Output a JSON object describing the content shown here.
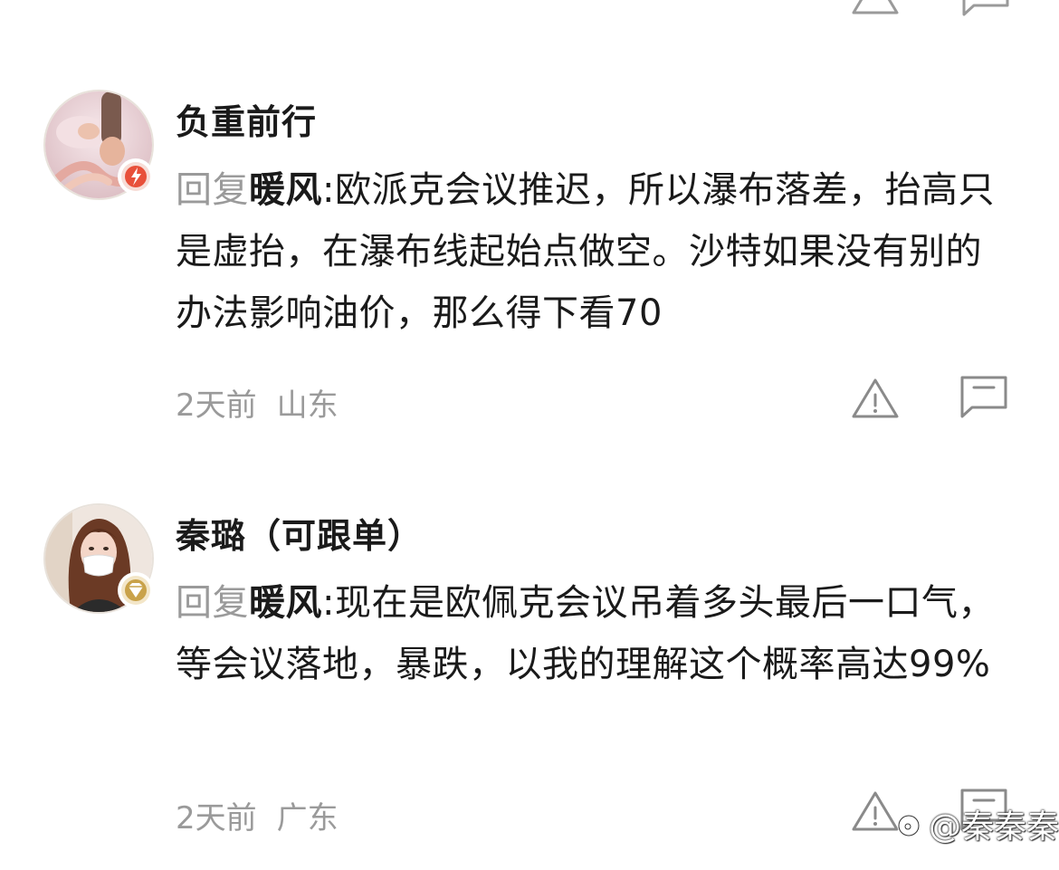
{
  "comments": [
    {
      "username": "负重前行",
      "reply_prefix": "回复",
      "reply_target": "暖风",
      "text": ":欧派克会议推迟，所以瀑布落差，抬高只是虚抬，在瀑布线起始点做空。沙特如果没有别的办法影响油价，那么得下看70",
      "time": "2天前",
      "location": "山东",
      "badge_icon": "flame-badge-icon",
      "badge_color": "#e8503a"
    },
    {
      "username": "秦璐（可跟单）",
      "reply_prefix": "回复",
      "reply_target": "暖风",
      "text": ":现在是欧佩克会议吊着多头最后一口气，等会议落地，暴跌，以我的理解这个概率高达99%",
      "time": "2天前",
      "location": "广东",
      "badge_icon": "diamond-badge-icon",
      "badge_color": "#c9a24a"
    }
  ],
  "watermark": {
    "text": "@秦秦秦"
  },
  "colors": {
    "text": "#1a1a1a",
    "muted": "#9a9a9a"
  }
}
